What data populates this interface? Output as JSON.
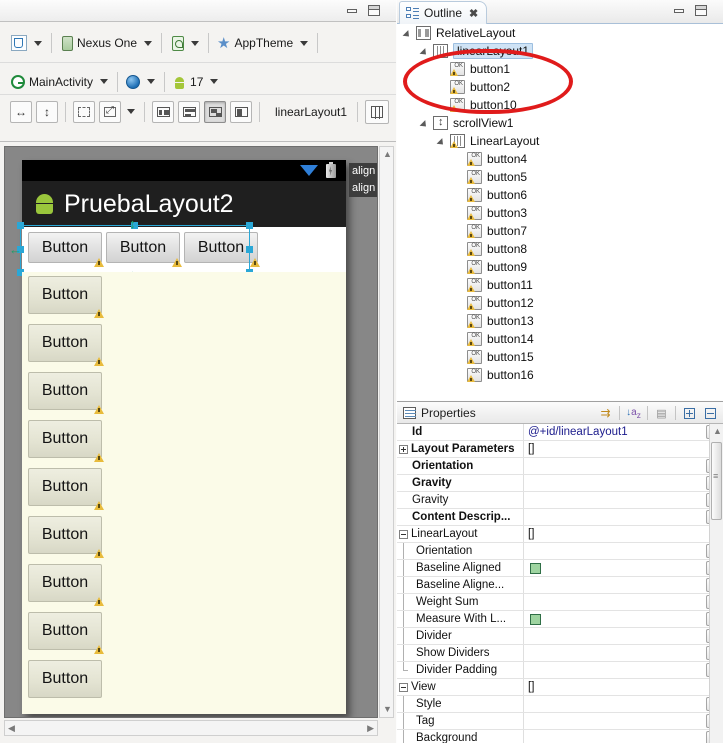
{
  "window": {
    "left_panel_minimize": "minimize",
    "left_panel_maximize": "maximize"
  },
  "editor_toolbar": {
    "row1": [
      {
        "icon": "config-icon",
        "label": "",
        "has_caret": true
      },
      {
        "icon": "device-icon",
        "label": "Nexus One",
        "has_caret": true
      },
      {
        "icon": "orientation-icon",
        "label": "",
        "has_caret": true
      },
      {
        "icon": "theme-star-icon",
        "label": "AppTheme",
        "has_caret": true
      }
    ],
    "row2": [
      {
        "icon": "activity-icon",
        "label": "MainActivity",
        "has_caret": true
      },
      {
        "icon": "locale-globe-icon",
        "label": "",
        "has_caret": true
      },
      {
        "icon": "android-api-icon",
        "label": "17",
        "has_caret": true
      }
    ],
    "row3": {
      "buttons": [
        "fit-width-icon",
        "fit-height-icon",
        "outline-mode-icon",
        "zoom-fit-icon",
        "distribute-horizontal-icon",
        "distribute-vertical-icon",
        "change-layout-icon",
        "extract-style-icon",
        "show-included-icon"
      ],
      "selection_id": "linearLayout1"
    }
  },
  "device_preview": {
    "app_title": "PruebaLayout2",
    "horizontal_buttons": [
      "Button",
      "Button",
      "Button"
    ],
    "vertical_buttons": [
      "Button",
      "Button",
      "Button",
      "Button",
      "Button",
      "Button",
      "Button",
      "Button",
      "Button"
    ],
    "tooltip_lines": [
      "align",
      "align"
    ],
    "selected_widget_id": "linearLayout1"
  },
  "outline": {
    "tab_label": "Outline",
    "tree": [
      {
        "label": "RelativeLayout",
        "depth": 0,
        "icon": "relative-layout-icon",
        "expander": true,
        "selected": false,
        "warn": false
      },
      {
        "label": "linearLayout1",
        "depth": 1,
        "icon": "linear-layout-icon",
        "expander": true,
        "selected": true,
        "warn": false
      },
      {
        "label": "button1",
        "depth": 2,
        "icon": "button-icon",
        "expander": false,
        "selected": false,
        "warn": true
      },
      {
        "label": "button2",
        "depth": 2,
        "icon": "button-icon",
        "expander": false,
        "selected": false,
        "warn": true
      },
      {
        "label": "button10",
        "depth": 2,
        "icon": "button-icon",
        "expander": false,
        "selected": false,
        "warn": true
      },
      {
        "label": "scrollView1",
        "depth": 1,
        "icon": "scrollview-icon",
        "expander": true,
        "selected": false,
        "warn": false
      },
      {
        "label": "LinearLayout",
        "depth": 2,
        "icon": "linear-layout-icon",
        "expander": true,
        "selected": false,
        "warn": true
      },
      {
        "label": "button4",
        "depth": 3,
        "icon": "button-icon",
        "expander": false,
        "selected": false,
        "warn": true
      },
      {
        "label": "button5",
        "depth": 3,
        "icon": "button-icon",
        "expander": false,
        "selected": false,
        "warn": true
      },
      {
        "label": "button6",
        "depth": 3,
        "icon": "button-icon",
        "expander": false,
        "selected": false,
        "warn": true
      },
      {
        "label": "button3",
        "depth": 3,
        "icon": "button-icon",
        "expander": false,
        "selected": false,
        "warn": true
      },
      {
        "label": "button7",
        "depth": 3,
        "icon": "button-icon",
        "expander": false,
        "selected": false,
        "warn": true
      },
      {
        "label": "button8",
        "depth": 3,
        "icon": "button-icon",
        "expander": false,
        "selected": false,
        "warn": true
      },
      {
        "label": "button9",
        "depth": 3,
        "icon": "button-icon",
        "expander": false,
        "selected": false,
        "warn": true
      },
      {
        "label": "button11",
        "depth": 3,
        "icon": "button-icon",
        "expander": false,
        "selected": false,
        "warn": true
      },
      {
        "label": "button12",
        "depth": 3,
        "icon": "button-icon",
        "expander": false,
        "selected": false,
        "warn": true
      },
      {
        "label": "button13",
        "depth": 3,
        "icon": "button-icon",
        "expander": false,
        "selected": false,
        "warn": true
      },
      {
        "label": "button14",
        "depth": 3,
        "icon": "button-icon",
        "expander": false,
        "selected": false,
        "warn": true
      },
      {
        "label": "button15",
        "depth": 3,
        "icon": "button-icon",
        "expander": false,
        "selected": false,
        "warn": true
      },
      {
        "label": "button16",
        "depth": 3,
        "icon": "button-icon",
        "expander": false,
        "selected": false,
        "warn": true
      }
    ],
    "annotation": {
      "shape": "ellipse",
      "color": "#e01b1b"
    }
  },
  "properties": {
    "tab_label": "Properties",
    "tools": [
      "show-advanced-icon",
      "sort-alphabetically-icon",
      "restore-default-icon",
      "expand-all-icon",
      "collapse-all-icon"
    ],
    "rows": [
      {
        "name": "Id",
        "value": "@+id/linearLayout1",
        "bold": true,
        "indent": 0,
        "expander": "none",
        "button": true,
        "check": false,
        "link": true
      },
      {
        "name": "Layout Parameters",
        "value": "[]",
        "bold": true,
        "indent": 0,
        "expander": "plus",
        "button": false,
        "check": false,
        "link": false
      },
      {
        "name": "Orientation",
        "value": "",
        "bold": true,
        "indent": 0,
        "expander": "none",
        "button": true,
        "check": false,
        "link": false
      },
      {
        "name": "Gravity",
        "value": "",
        "bold": true,
        "indent": 0,
        "expander": "none",
        "button": true,
        "check": false,
        "link": false
      },
      {
        "name": "Gravity",
        "value": "",
        "bold": false,
        "indent": 0,
        "expander": "none",
        "button": true,
        "check": false,
        "link": false
      },
      {
        "name": "Content Descrip...",
        "value": "",
        "bold": true,
        "indent": 0,
        "expander": "none",
        "button": true,
        "check": false,
        "link": false
      },
      {
        "name": "LinearLayout",
        "value": "[]",
        "bold": false,
        "indent": 0,
        "expander": "minus",
        "button": false,
        "check": false,
        "link": false
      },
      {
        "name": "Orientation",
        "value": "",
        "bold": false,
        "indent": 1,
        "expander": "none",
        "button": true,
        "check": false,
        "link": false
      },
      {
        "name": "Baseline Aligned",
        "value": "",
        "bold": false,
        "indent": 1,
        "expander": "none",
        "button": true,
        "check": true,
        "link": false
      },
      {
        "name": "Baseline Aligne...",
        "value": "",
        "bold": false,
        "indent": 1,
        "expander": "none",
        "button": true,
        "check": false,
        "link": false
      },
      {
        "name": "Weight Sum",
        "value": "",
        "bold": false,
        "indent": 1,
        "expander": "none",
        "button": true,
        "check": false,
        "link": false
      },
      {
        "name": "Measure With L...",
        "value": "",
        "bold": false,
        "indent": 1,
        "expander": "none",
        "button": true,
        "check": true,
        "link": false
      },
      {
        "name": "Divider",
        "value": "",
        "bold": false,
        "indent": 1,
        "expander": "none",
        "button": true,
        "check": false,
        "link": false
      },
      {
        "name": "Show Dividers",
        "value": "",
        "bold": false,
        "indent": 1,
        "expander": "none",
        "button": true,
        "check": false,
        "link": false
      },
      {
        "name": "Divider Padding",
        "value": "",
        "bold": false,
        "indent": 1,
        "expander": "none",
        "button": true,
        "check": false,
        "link": false,
        "last_child": true
      },
      {
        "name": "View",
        "value": "[]",
        "bold": false,
        "indent": 0,
        "expander": "minus",
        "button": false,
        "check": false,
        "link": false
      },
      {
        "name": "Style",
        "value": "",
        "bold": false,
        "indent": 1,
        "expander": "none",
        "button": true,
        "check": false,
        "link": false
      },
      {
        "name": "Tag",
        "value": "",
        "bold": false,
        "indent": 1,
        "expander": "none",
        "button": true,
        "check": false,
        "link": false
      },
      {
        "name": "Background",
        "value": "",
        "bold": false,
        "indent": 1,
        "expander": "none",
        "button": true,
        "check": false,
        "link": false
      }
    ]
  },
  "colors": {
    "selection_blue": "#2aa7d6",
    "annotation_red": "#e01b1b",
    "scroll_bg": "#fbfbe8",
    "android_green": "#a4c639"
  }
}
